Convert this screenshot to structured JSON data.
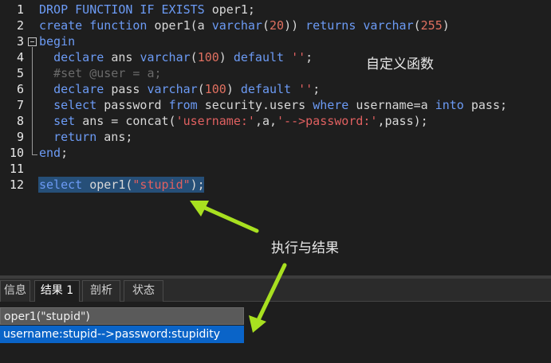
{
  "editor": {
    "lines": [
      {
        "n": "1",
        "tokens": [
          [
            "kw",
            "DROP FUNCTION IF EXISTS "
          ],
          [
            "plain",
            "oper1;"
          ]
        ]
      },
      {
        "n": "2",
        "tokens": [
          [
            "kw",
            "create function "
          ],
          [
            "plain",
            "oper1(a "
          ],
          [
            "kw",
            "varchar"
          ],
          [
            "plain",
            "("
          ],
          [
            "num",
            "20"
          ],
          [
            "plain",
            ")) "
          ],
          [
            "kw",
            "returns varchar"
          ],
          [
            "plain",
            "("
          ],
          [
            "num",
            "255"
          ],
          [
            "plain",
            ")"
          ]
        ]
      },
      {
        "n": "3",
        "tokens": [
          [
            "kw",
            "begin"
          ]
        ]
      },
      {
        "n": "4",
        "tokens": [
          [
            "plain",
            "  "
          ],
          [
            "kw",
            "declare "
          ],
          [
            "plain",
            "ans "
          ],
          [
            "kw",
            "varchar"
          ],
          [
            "plain",
            "("
          ],
          [
            "num",
            "100"
          ],
          [
            "plain",
            ") "
          ],
          [
            "kw",
            "default "
          ],
          [
            "str",
            "''"
          ],
          [
            "plain",
            ";"
          ]
        ]
      },
      {
        "n": "5",
        "tokens": [
          [
            "cmt",
            "  #set @user = a;"
          ]
        ]
      },
      {
        "n": "6",
        "tokens": [
          [
            "plain",
            "  "
          ],
          [
            "kw",
            "declare "
          ],
          [
            "plain",
            "pass "
          ],
          [
            "kw",
            "varchar"
          ],
          [
            "plain",
            "("
          ],
          [
            "num",
            "100"
          ],
          [
            "plain",
            ") "
          ],
          [
            "kw",
            "default "
          ],
          [
            "str",
            "''"
          ],
          [
            "plain",
            ";"
          ]
        ]
      },
      {
        "n": "7",
        "tokens": [
          [
            "plain",
            "  "
          ],
          [
            "kw",
            "select "
          ],
          [
            "plain",
            "password "
          ],
          [
            "kw",
            "from "
          ],
          [
            "plain",
            "security.users "
          ],
          [
            "kw",
            "where "
          ],
          [
            "plain",
            "username=a "
          ],
          [
            "kw",
            "into "
          ],
          [
            "plain",
            "pass;"
          ]
        ]
      },
      {
        "n": "8",
        "tokens": [
          [
            "plain",
            "  "
          ],
          [
            "kw",
            "set "
          ],
          [
            "plain",
            "ans = concat("
          ],
          [
            "str",
            "'username:'"
          ],
          [
            "plain",
            ",a,"
          ],
          [
            "str",
            "'-->password:'"
          ],
          [
            "plain",
            ",pass);"
          ]
        ]
      },
      {
        "n": "9",
        "tokens": [
          [
            "plain",
            "  "
          ],
          [
            "kw",
            "return "
          ],
          [
            "plain",
            "ans;"
          ]
        ]
      },
      {
        "n": "10",
        "tokens": [
          [
            "kw",
            "end"
          ],
          [
            "plain",
            ";"
          ]
        ]
      },
      {
        "n": "11",
        "tokens": []
      },
      {
        "n": "12",
        "tokens": [
          [
            "kw",
            "select "
          ],
          [
            "plain",
            "oper1("
          ],
          [
            "str",
            "\"stupid\""
          ],
          [
            "plain",
            ");"
          ]
        ]
      }
    ]
  },
  "annotations": {
    "custom_function": "自定义函数",
    "execute_result": "执行与结果"
  },
  "tabs": [
    {
      "label": "信息",
      "active": false
    },
    {
      "label": "结果 1",
      "active": true
    },
    {
      "label": "剖析",
      "active": false
    },
    {
      "label": "状态",
      "active": false
    }
  ],
  "result": {
    "column": "oper1(\"stupid\")",
    "value": "username:stupid-->password:stupidity"
  },
  "colors": {
    "arrow": "#a8e020",
    "selection": "#264f78",
    "selected_cell": "#0a64c8"
  }
}
